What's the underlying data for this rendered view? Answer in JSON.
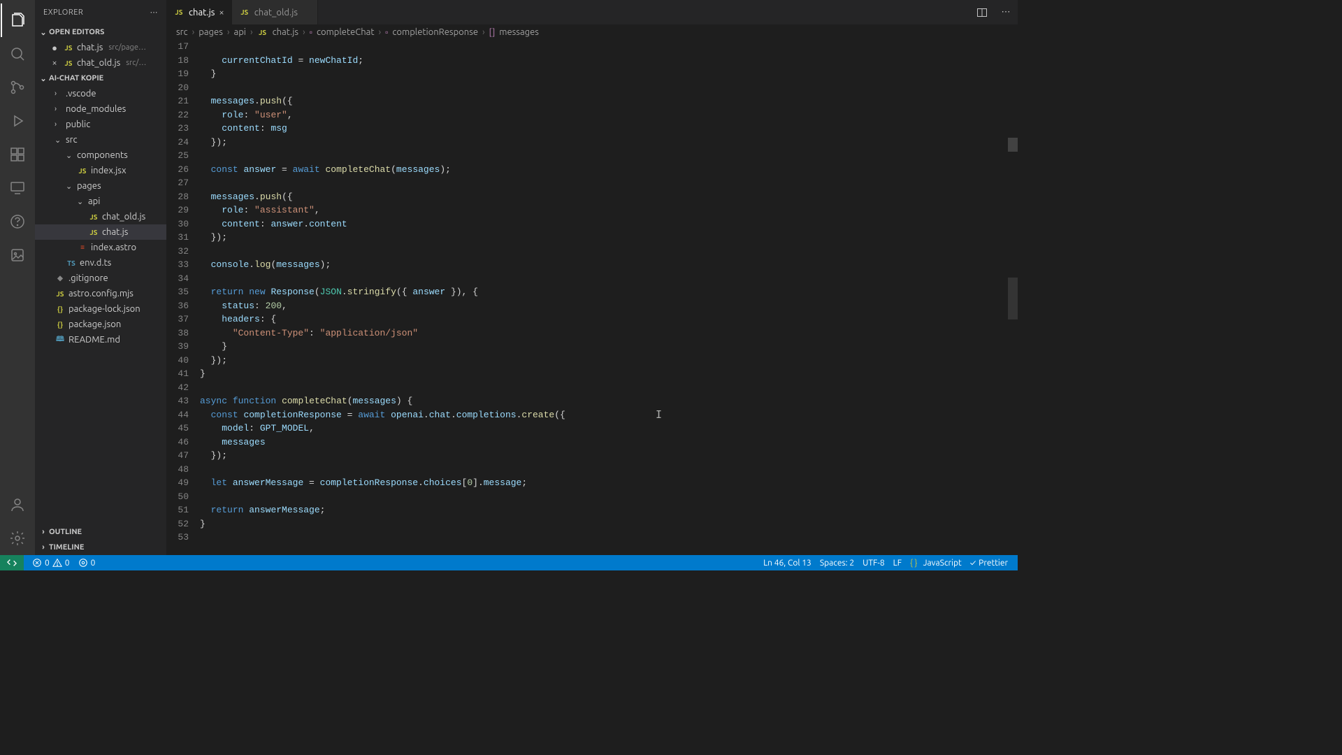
{
  "activityBar": {
    "items": [
      "files",
      "search",
      "scm",
      "debug",
      "extensions",
      "remote",
      "marketplace",
      "images"
    ],
    "bottom": [
      "account",
      "settings"
    ]
  },
  "sidebar": {
    "title": "EXPLORER",
    "sections": {
      "openEditors": {
        "label": "OPEN EDITORS"
      },
      "project": {
        "label": "AI-CHAT KOPIE"
      },
      "outline": {
        "label": "OUTLINE"
      },
      "timeline": {
        "label": "TIMELINE"
      }
    },
    "openEditors": [
      {
        "name": "chat.js",
        "icon": "js",
        "hint": "src/page…",
        "dirty": true
      },
      {
        "name": "chat_old.js",
        "icon": "js",
        "hint": "src/…",
        "dirty": false
      }
    ],
    "tree": [
      {
        "depth": 1,
        "type": "folder",
        "name": ".vscode",
        "open": false
      },
      {
        "depth": 1,
        "type": "folder",
        "name": "node_modules",
        "open": false
      },
      {
        "depth": 1,
        "type": "folder",
        "name": "public",
        "open": false
      },
      {
        "depth": 1,
        "type": "folder",
        "name": "src",
        "open": true
      },
      {
        "depth": 2,
        "type": "folder",
        "name": "components",
        "open": true
      },
      {
        "depth": 3,
        "type": "file",
        "name": "index.jsx",
        "icon": "js"
      },
      {
        "depth": 2,
        "type": "folder",
        "name": "pages",
        "open": true
      },
      {
        "depth": 3,
        "type": "folder",
        "name": "api",
        "open": true
      },
      {
        "depth": 4,
        "type": "file",
        "name": "chat_old.js",
        "icon": "js"
      },
      {
        "depth": 4,
        "type": "file",
        "name": "chat.js",
        "icon": "js",
        "active": true
      },
      {
        "depth": 3,
        "type": "file",
        "name": "index.astro",
        "icon": "astro"
      },
      {
        "depth": 2,
        "type": "file",
        "name": "env.d.ts",
        "icon": "ts"
      },
      {
        "depth": 1,
        "type": "file",
        "name": ".gitignore",
        "icon": "dot"
      },
      {
        "depth": 1,
        "type": "file",
        "name": "astro.config.mjs",
        "icon": "js"
      },
      {
        "depth": 1,
        "type": "file",
        "name": "package-lock.json",
        "icon": "json"
      },
      {
        "depth": 1,
        "type": "file",
        "name": "package.json",
        "icon": "json"
      },
      {
        "depth": 1,
        "type": "file",
        "name": "README.md",
        "icon": "md"
      }
    ]
  },
  "tabs": [
    {
      "label": "chat.js",
      "icon": "js",
      "active": true,
      "closable": true
    },
    {
      "label": "chat_old.js",
      "icon": "js",
      "active": false,
      "closable": false
    }
  ],
  "breadcrumbs": [
    "src",
    "pages",
    "api",
    "chat.js",
    "completeChat",
    "completionResponse",
    "messages"
  ],
  "code": {
    "startLine": 17,
    "lines": [
      "",
      "    currentChatId = newChatId;",
      "  }",
      "",
      "  messages.push({",
      "    role: \"user\",",
      "    content: msg",
      "  });",
      "",
      "  const answer = await completeChat(messages);",
      "",
      "  messages.push({",
      "    role: \"assistant\",",
      "    content: answer.content",
      "  });",
      "",
      "  console.log(messages);",
      "",
      "  return new Response(JSON.stringify({ answer }), {",
      "    status: 200,",
      "    headers: {",
      "      \"Content-Type\": \"application/json\"",
      "    }",
      "  });",
      "}",
      "",
      "async function completeChat(messages) {",
      "  const completionResponse = await openai.chat.completions.create({",
      "    model: GPT_MODEL,",
      "    messages",
      "  });",
      "",
      "  let answerMessage = completionResponse.choices[0].message;",
      "",
      "  return answerMessage;",
      "}",
      ""
    ]
  },
  "statusbar": {
    "errors": "0",
    "warnings": "0",
    "ports": "0",
    "cursor": "Ln 46, Col 13",
    "spaces": "Spaces: 2",
    "encoding": "UTF-8",
    "eol": "LF",
    "lang": "JavaScript",
    "prettier": "Prettier"
  }
}
